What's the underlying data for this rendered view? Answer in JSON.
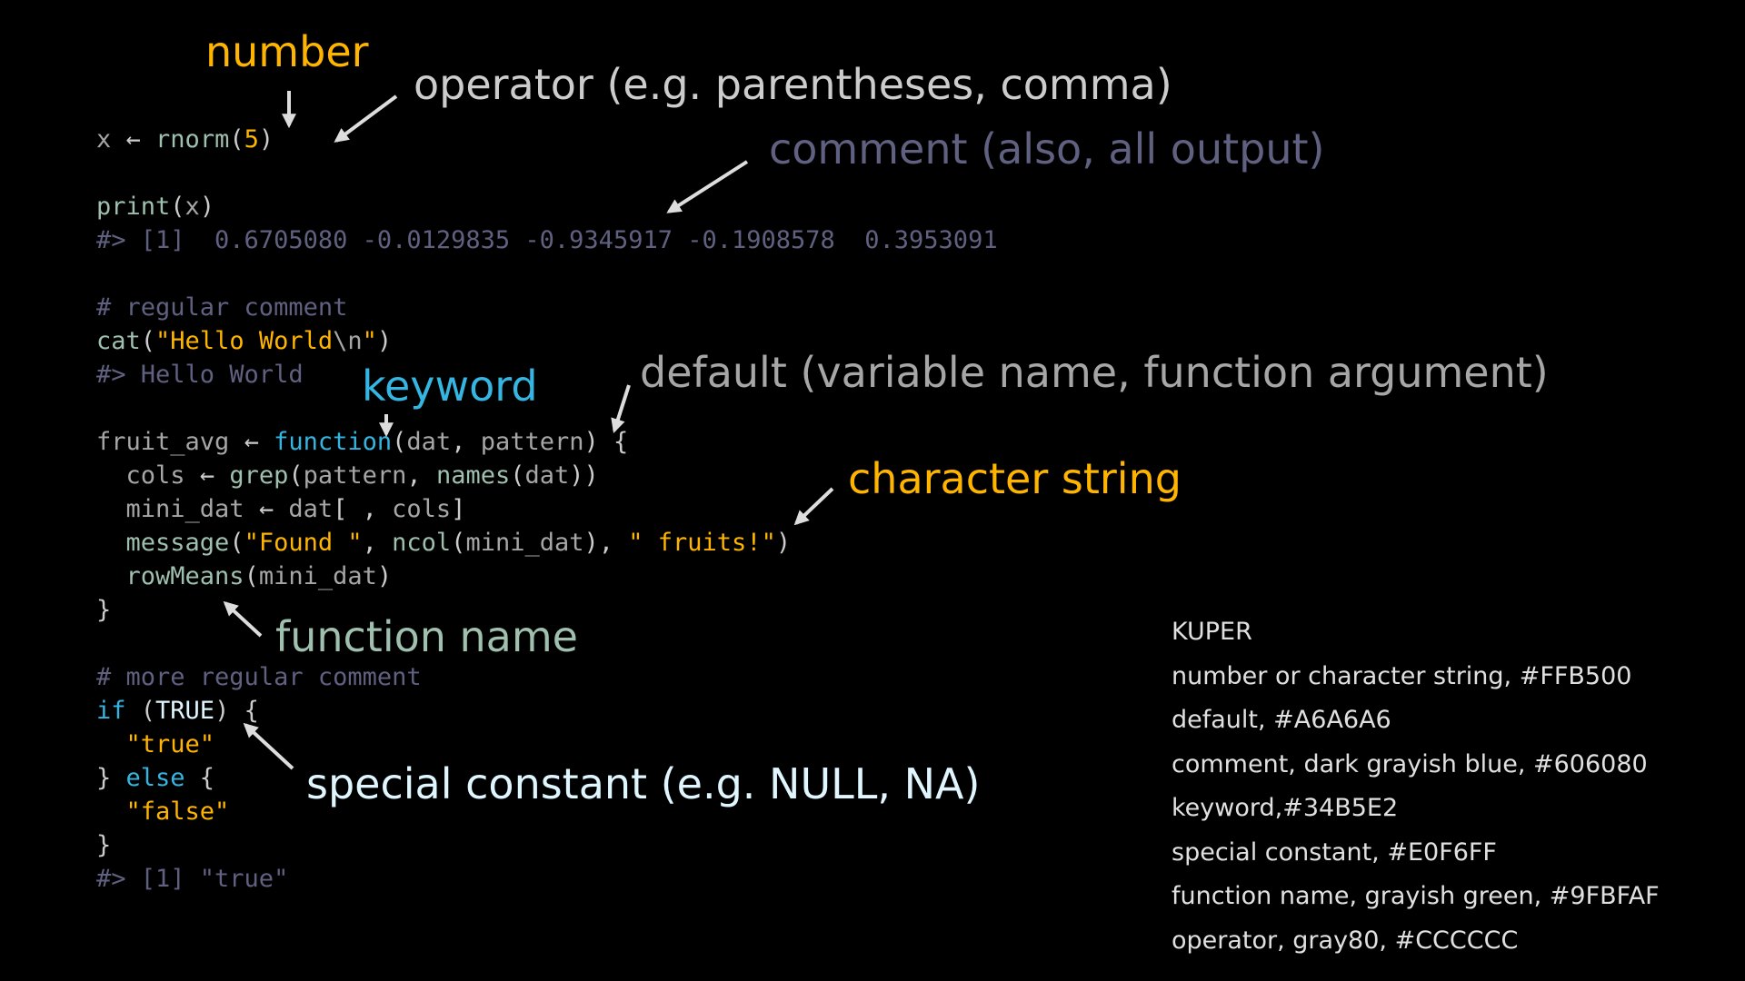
{
  "code_lines": [
    [
      {
        "t": "x ",
        "c": "def"
      },
      {
        "t": "←",
        "c": "op"
      },
      {
        "t": " ",
        "c": "def"
      },
      {
        "t": "rnorm",
        "c": "fn"
      },
      {
        "t": "(",
        "c": "op"
      },
      {
        "t": "5",
        "c": "num"
      },
      {
        "t": ")",
        "c": "op"
      }
    ],
    [],
    [
      {
        "t": "print",
        "c": "fn"
      },
      {
        "t": "(",
        "c": "op"
      },
      {
        "t": "x",
        "c": "def"
      },
      {
        "t": ")",
        "c": "op"
      }
    ],
    [
      {
        "t": "#> [1]  0.6705080 -0.0129835 -0.9345917 -0.1908578  0.3953091",
        "c": "cmt"
      }
    ],
    [],
    [
      {
        "t": "# regular comment",
        "c": "cmt"
      }
    ],
    [
      {
        "t": "cat",
        "c": "fn"
      },
      {
        "t": "(",
        "c": "op"
      },
      {
        "t": "\"Hello World",
        "c": "str"
      },
      {
        "t": "\\n",
        "c": "def"
      },
      {
        "t": "\"",
        "c": "str"
      },
      {
        "t": ")",
        "c": "op"
      }
    ],
    [
      {
        "t": "#> Hello World",
        "c": "cmt"
      }
    ],
    [],
    [
      {
        "t": "fruit_avg ",
        "c": "def"
      },
      {
        "t": "←",
        "c": "op"
      },
      {
        "t": " ",
        "c": "def"
      },
      {
        "t": "function",
        "c": "kw"
      },
      {
        "t": "(",
        "c": "op"
      },
      {
        "t": "dat",
        "c": "def"
      },
      {
        "t": ", ",
        "c": "op"
      },
      {
        "t": "pattern",
        "c": "def"
      },
      {
        "t": ") {",
        "c": "op"
      }
    ],
    [
      {
        "t": "  cols ",
        "c": "def"
      },
      {
        "t": "←",
        "c": "op"
      },
      {
        "t": " ",
        "c": "def"
      },
      {
        "t": "grep",
        "c": "fn"
      },
      {
        "t": "(",
        "c": "op"
      },
      {
        "t": "pattern",
        "c": "def"
      },
      {
        "t": ", ",
        "c": "op"
      },
      {
        "t": "names",
        "c": "fn"
      },
      {
        "t": "(",
        "c": "op"
      },
      {
        "t": "dat",
        "c": "def"
      },
      {
        "t": "))",
        "c": "op"
      }
    ],
    [
      {
        "t": "  mini_dat ",
        "c": "def"
      },
      {
        "t": "←",
        "c": "op"
      },
      {
        "t": " dat",
        "c": "def"
      },
      {
        "t": "[ , ",
        "c": "op"
      },
      {
        "t": "cols",
        "c": "def"
      },
      {
        "t": "]",
        "c": "op"
      }
    ],
    [
      {
        "t": "  message",
        "c": "fn"
      },
      {
        "t": "(",
        "c": "op"
      },
      {
        "t": "\"Found \"",
        "c": "str"
      },
      {
        "t": ", ",
        "c": "op"
      },
      {
        "t": "ncol",
        "c": "fn"
      },
      {
        "t": "(",
        "c": "op"
      },
      {
        "t": "mini_dat",
        "c": "def"
      },
      {
        "t": "), ",
        "c": "op"
      },
      {
        "t": "\" fruits!\"",
        "c": "str"
      },
      {
        "t": ")",
        "c": "op"
      }
    ],
    [
      {
        "t": "  rowMeans",
        "c": "fn"
      },
      {
        "t": "(",
        "c": "op"
      },
      {
        "t": "mini_dat",
        "c": "def"
      },
      {
        "t": ")",
        "c": "op"
      }
    ],
    [
      {
        "t": "}",
        "c": "op"
      }
    ],
    [],
    [
      {
        "t": "# more regular comment",
        "c": "cmt"
      }
    ],
    [
      {
        "t": "if",
        "c": "kw"
      },
      {
        "t": " (",
        "c": "op"
      },
      {
        "t": "TRUE",
        "c": "const"
      },
      {
        "t": ") {",
        "c": "op"
      }
    ],
    [
      {
        "t": "  ",
        "c": "def"
      },
      {
        "t": "\"true\"",
        "c": "str"
      }
    ],
    [
      {
        "t": "} ",
        "c": "op"
      },
      {
        "t": "else",
        "c": "kw"
      },
      {
        "t": " {",
        "c": "op"
      }
    ],
    [
      {
        "t": "  ",
        "c": "def"
      },
      {
        "t": "\"false\"",
        "c": "str"
      }
    ],
    [
      {
        "t": "}",
        "c": "op"
      }
    ],
    [
      {
        "t": "#> [1] \"true\"",
        "c": "cmt"
      }
    ]
  ],
  "annotations": {
    "number": {
      "label": "number",
      "color": "#FFB500"
    },
    "operator": {
      "label": "operator (e.g. parentheses, comma)",
      "color": "#CCCCCC"
    },
    "comment": {
      "label": "comment (also, all output)",
      "color": "#606080"
    },
    "default": {
      "label": "default (variable name, function argument)",
      "color": "#A6A6A6"
    },
    "keyword": {
      "label": "keyword",
      "color": "#34B5E2"
    },
    "character_string": {
      "label": "character string",
      "color": "#FFB500"
    },
    "function_name": {
      "label": "function name",
      "color": "#9FBFAF"
    },
    "special_constant": {
      "label": "special constant (e.g. NULL, NA)",
      "color": "#E0F6FF"
    }
  },
  "legend": {
    "title": "KUPER",
    "items": [
      "number or character string, #FFB500",
      "default, #A6A6A6",
      "comment, dark grayish blue, #606080",
      "keyword,#34B5E2",
      "special constant, #E0F6FF",
      "function name, grayish green, #9FBFAF",
      "operator, gray80, #CCCCCC"
    ]
  },
  "colors": {
    "background": "#000000",
    "arrow": "#DDDDDD"
  }
}
